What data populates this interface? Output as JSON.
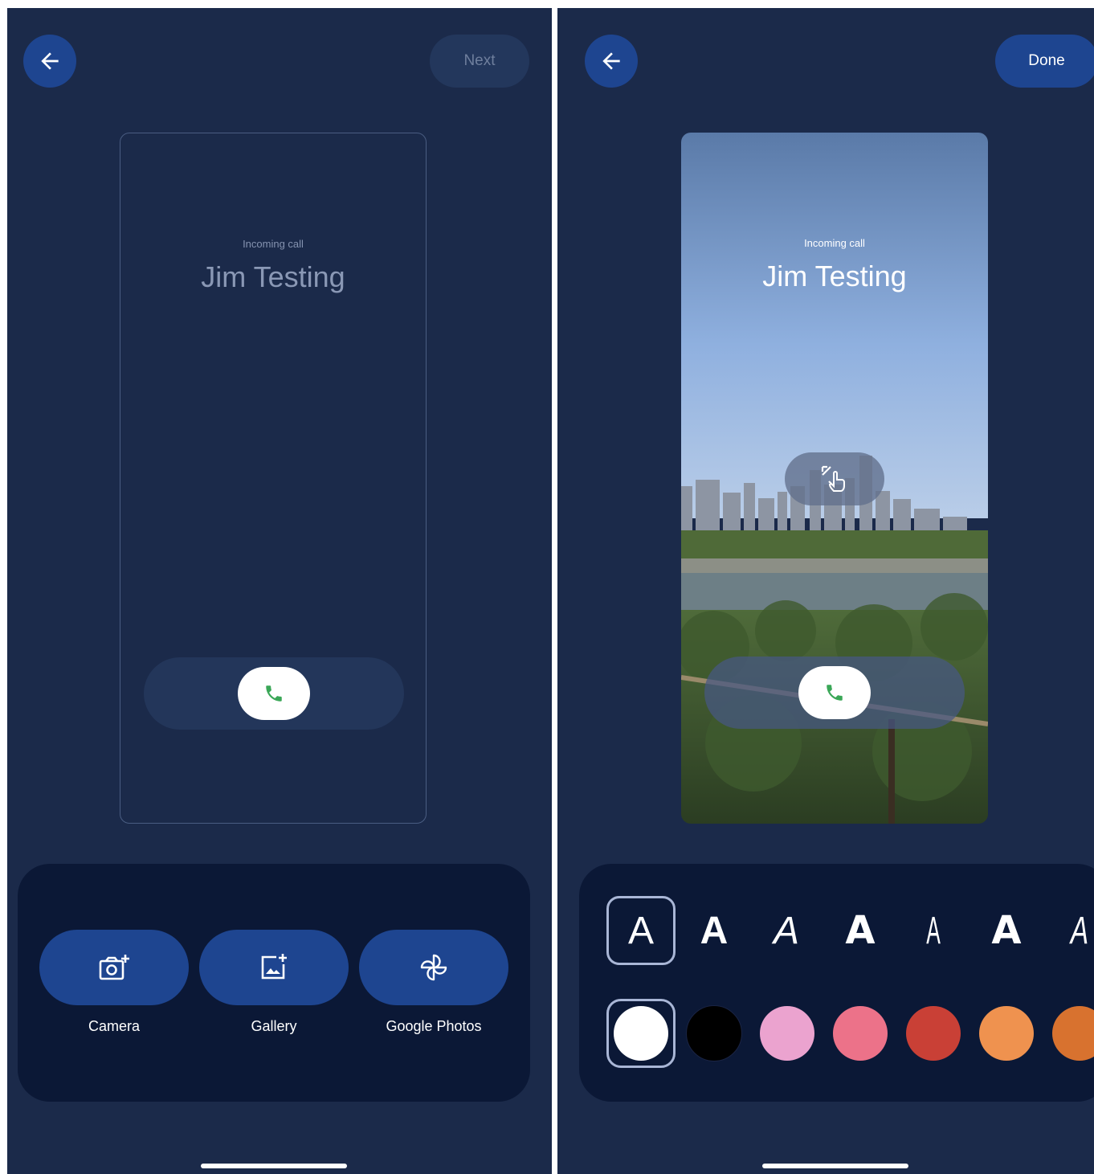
{
  "left_screen": {
    "next_label": "Next",
    "incoming_label": "Incoming call",
    "caller_name": "Jim Testing",
    "sources": [
      {
        "label": "Camera",
        "icon": "camera-add-icon"
      },
      {
        "label": "Gallery",
        "icon": "gallery-add-icon"
      },
      {
        "label": "Google Photos",
        "icon": "google-photos-icon"
      }
    ]
  },
  "right_screen": {
    "done_label": "Done",
    "incoming_label": "Incoming call",
    "caller_name": "Jim Testing",
    "font_glyph": "A",
    "font_styles": [
      "regular",
      "rounded",
      "italic-light",
      "black",
      "condensed-thin",
      "bold-geometric",
      "italic-condensed"
    ],
    "selected_font_index": 0,
    "colors": [
      "#ffffff",
      "#000000",
      "#eba3cf",
      "#ec7289",
      "#c94036",
      "#ef924f",
      "#d8722f"
    ],
    "selected_color_index": 0
  },
  "colors": {
    "background": "#1b2a4a",
    "panel": "#0b1836",
    "primary_button": "#1e4590",
    "answer_icon": "#3aa757"
  }
}
